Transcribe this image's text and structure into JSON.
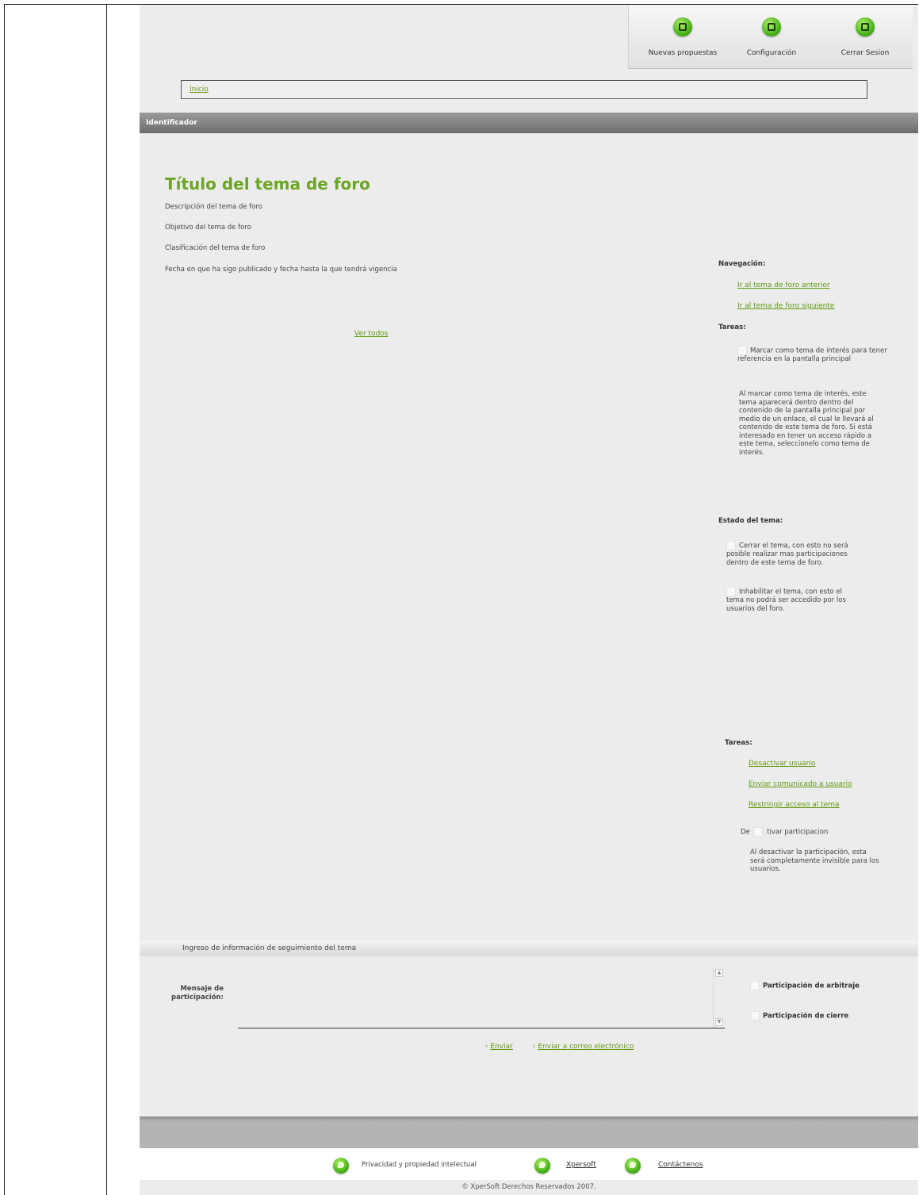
{
  "toolbar": {
    "items": [
      {
        "label": "Nuevas propuestas",
        "icon": "new-proposal-icon"
      },
      {
        "label": "Configuración",
        "icon": "settings-icon"
      },
      {
        "label": "Cerrar Sesion",
        "icon": "logout-icon"
      }
    ]
  },
  "breadcrumb": {
    "home": "Inicio"
  },
  "header_bar": {
    "label": "Identificador"
  },
  "topic": {
    "title": "Título del tema de foro",
    "description": "Descripción del tema de foro",
    "objective": "Objetivo del tema de foro",
    "classification": "Clasificación del tema de foro",
    "dates": "Fecha en que ha sigo publicado y fecha hasta la que tendrá vigencia",
    "see_all": "Ver todos"
  },
  "navigation": {
    "title": "Navegación:",
    "prev": "Ir al tema de foro anterior",
    "next": "Ir al tema de foro siguiente"
  },
  "tasks1": {
    "title": "Tareas:",
    "mark_interest": "Marcar como tema de interés para tener referencia en la pantalla principal",
    "mark_help": "Al marcar como tema de interés, este tema aparecerá dentro dentro del contenido de la pantalla principal por medio de un enlace, el cual le llevará al contenido de este tema de foro. Si está interesado en tener un acceso rápido a este tema, seleccionelo como tema de interés."
  },
  "topic_state": {
    "title": "Estado del tema:",
    "close": "Cerrar el tema, con esto no será posible realizar mas participaciones dentro de este tema de foro.",
    "disable": "Inhabilitar el tema, con esto el tema no podrá ser accedido por los usuarios del foro."
  },
  "tasks2": {
    "title": "Tareas:",
    "deactivate_user": "Desactivar usuario",
    "send_message": "Enviar comunicado a usuario",
    "restrict_access": "Restringir acceso al tema",
    "deactivate_participation": "Desactivar participacion",
    "deactivate_left": "De",
    "deactivate_right": "tivar participacion",
    "deactivate_help": "Al desactivar la participación, esta será completamente invisible para los usuarios."
  },
  "follow_up": {
    "section_title": "Ingreso de información de seguimiento del tema",
    "message_label": "Mensaje de participación:",
    "arbitration": "Participación de arbitraje",
    "closing": "Participación de cierre",
    "send": "Enviar",
    "send_email": "Enviar a correo electrónico"
  },
  "footer": {
    "privacy": "Privacidad y propiedad intelectual",
    "xpersoft": "Xpersoft",
    "contact": "Contáctenos",
    "copyright": "© XperSoft Derechos Reservados 2007."
  }
}
